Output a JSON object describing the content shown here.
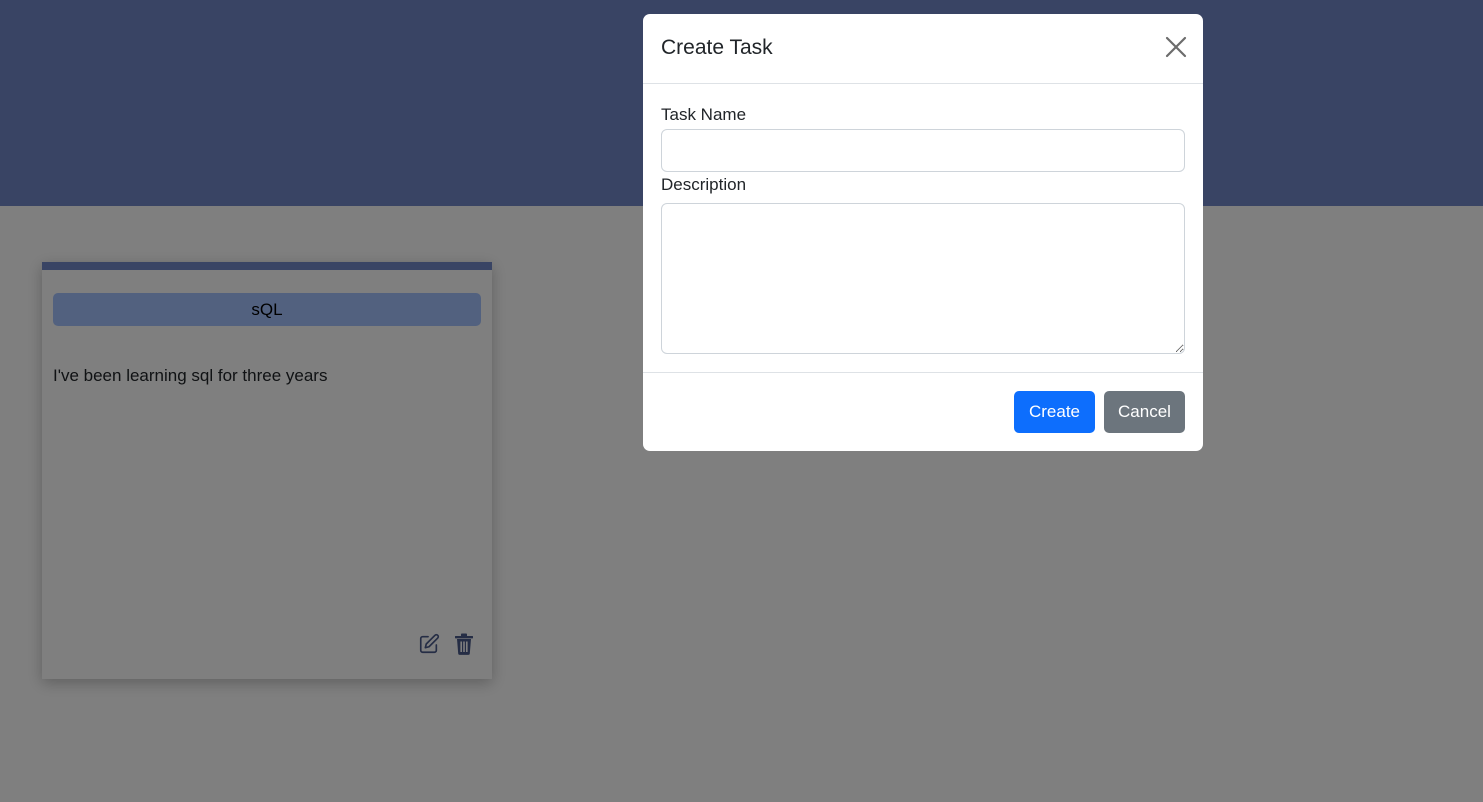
{
  "task_card": {
    "tag": "sQL",
    "description": "I've been learning sql for three years",
    "edit_icon": "edit-icon",
    "delete_icon": "trash-icon"
  },
  "modal": {
    "title": "Create Task",
    "close_icon": "close-icon",
    "task_name_label": "Task Name",
    "task_name_value": "",
    "description_label": "Description",
    "description_value": "",
    "create_label": "Create",
    "cancel_label": "Cancel"
  },
  "colors": {
    "header": "#7289c9",
    "tag": "#a5c3ff",
    "primary": "#0d6efd",
    "secondary": "#6c757d"
  }
}
